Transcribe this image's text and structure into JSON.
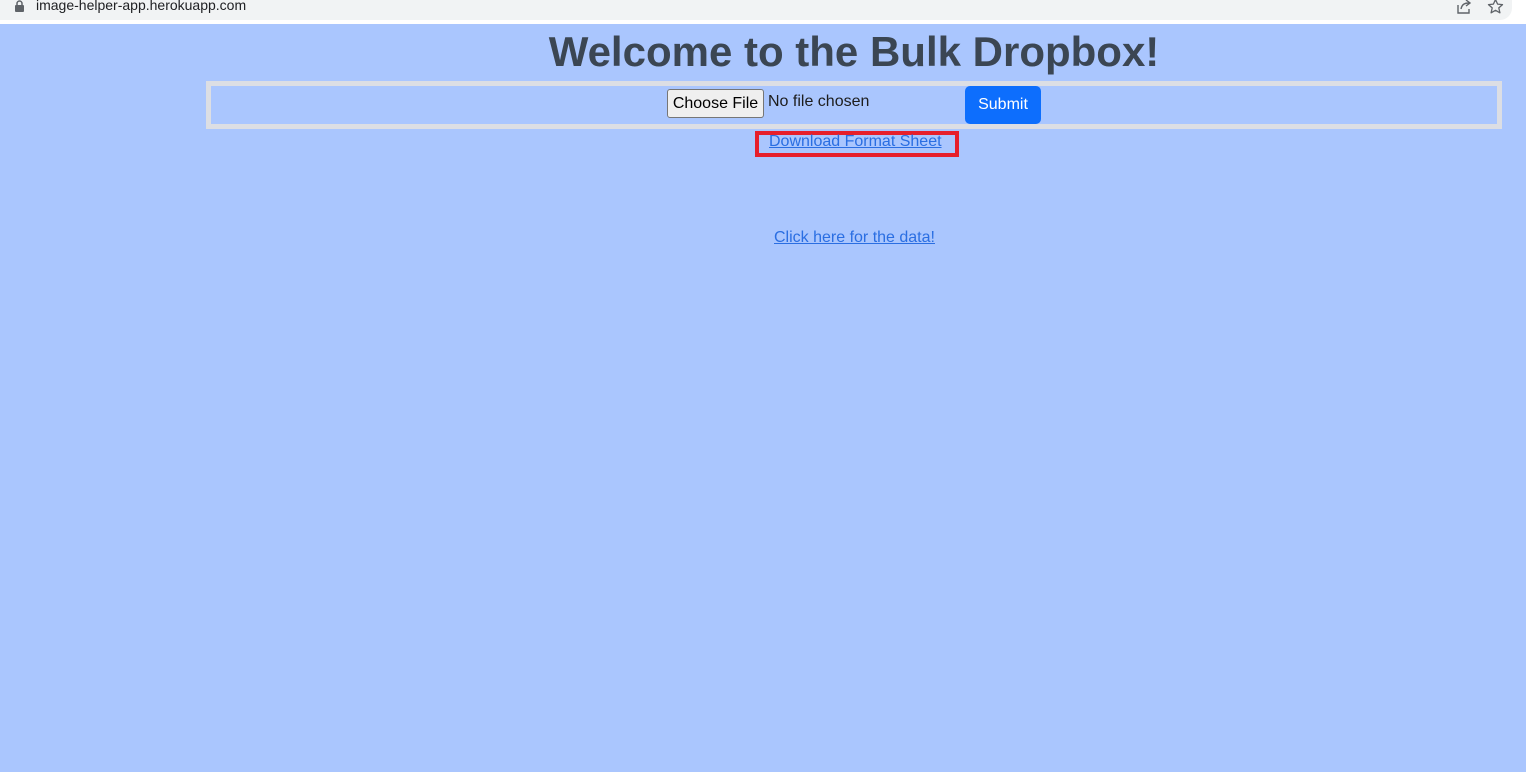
{
  "browser": {
    "url": "image-helper-app.herokuapp.com",
    "icons": [
      "lock-icon",
      "share-icon",
      "star-icon"
    ]
  },
  "page": {
    "title": "Welcome to the Bulk Dropbox!",
    "form": {
      "choose_file_label": "Choose File",
      "file_status": "No file chosen",
      "submit_label": "Submit"
    },
    "links": {
      "download_format_sheet": "Download Format Sheet",
      "data_link": "Click here for the data!"
    }
  },
  "colors": {
    "background": "#aac6fe",
    "title": "#3b4653",
    "submit": "#0d6efd",
    "link": "#2a6ee2",
    "highlight": "#e61f2b",
    "form_border": "#dcdee4"
  }
}
